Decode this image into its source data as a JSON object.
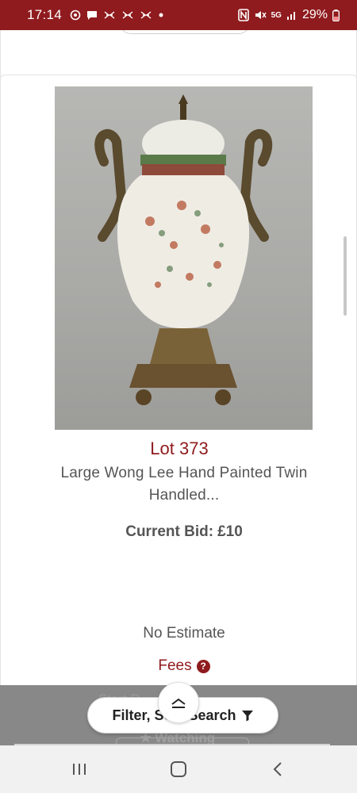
{
  "status_bar": {
    "time": "17:14",
    "battery": "29%",
    "network": "5G"
  },
  "lot": {
    "number": "Lot 373",
    "title": "Large Wong Lee Hand Painted Twin Handled...",
    "current_bid_label": "Current Bid:",
    "current_bid_value": "£10",
    "estimate": "No Estimate",
    "fees_label": "Fees"
  },
  "overlay": {
    "partial_text": "Start D... ... 2022",
    "watching_label": "Watching"
  },
  "filter_button": {
    "label": "Filter, So... Search"
  },
  "colors": {
    "brand": "#8f1b1e",
    "text": "#555555",
    "overlay": "#888888"
  },
  "icons": [
    "instagram-icon",
    "message-icon",
    "nfc-icon",
    "mute-icon",
    "signal-icon",
    "battery-icon",
    "question-icon",
    "filter-icon",
    "chevron-up-icon",
    "recents-icon",
    "home-icon",
    "back-icon",
    "star-icon"
  ]
}
